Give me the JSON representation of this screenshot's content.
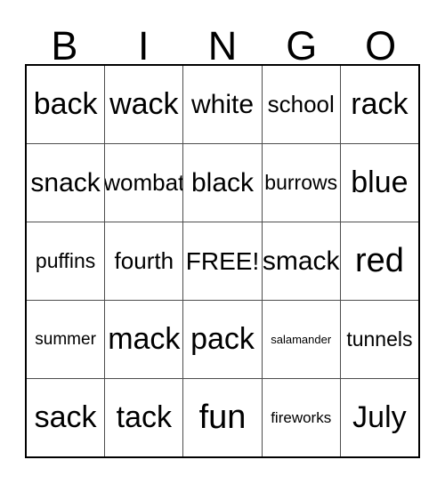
{
  "card": {
    "title_letters": [
      "B",
      "I",
      "N",
      "G",
      "O"
    ],
    "free_space_label": "FREE!",
    "colors": {
      "background": "#ffffff",
      "text": "#000000",
      "outer_border": "#000000",
      "inner_grid_line": "#4d4d4d"
    },
    "grid": {
      "columns": 5,
      "rows": 5,
      "cells": [
        [
          {
            "text": "back",
            "size": "len-4"
          },
          {
            "text": "wack",
            "size": "len-4"
          },
          {
            "text": "white",
            "size": "len-5"
          },
          {
            "text": "school",
            "size": "len-6"
          },
          {
            "text": "rack",
            "size": "len-4"
          }
        ],
        [
          {
            "text": "snack",
            "size": "len-5"
          },
          {
            "text": "wombat",
            "size": "len-6"
          },
          {
            "text": "black",
            "size": "len-5"
          },
          {
            "text": "burrows",
            "size": "len-7"
          },
          {
            "text": "blue",
            "size": "len-4"
          }
        ],
        [
          {
            "text": "puffins",
            "size": "len-7"
          },
          {
            "text": "fourth",
            "size": "len-6"
          },
          {
            "text": "FREE!",
            "size": "free"
          },
          {
            "text": "smack",
            "size": "len-5"
          },
          {
            "text": "red",
            "size": "len-3"
          }
        ],
        [
          {
            "text": "summer",
            "size": "len-8"
          },
          {
            "text": "mack",
            "size": "len-4"
          },
          {
            "text": "pack",
            "size": "len-4"
          },
          {
            "text": "salamander",
            "size": "len-10"
          },
          {
            "text": "tunnels",
            "size": "len-7"
          }
        ],
        [
          {
            "text": "sack",
            "size": "len-4"
          },
          {
            "text": "tack",
            "size": "len-4"
          },
          {
            "text": "fun",
            "size": "len-3"
          },
          {
            "text": "fireworks",
            "size": "len-9"
          },
          {
            "text": "July",
            "size": "len-4"
          }
        ]
      ]
    }
  }
}
